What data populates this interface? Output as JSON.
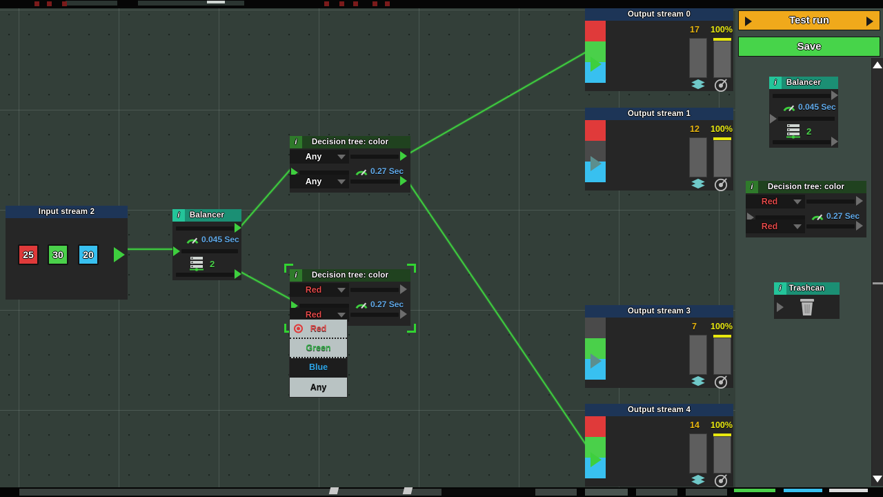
{
  "app": {
    "background_color": "#333f39",
    "wire_color": "#3ecf3e"
  },
  "sidebar": {
    "test_run_label": "Test run",
    "save_label": "Save",
    "test_run_color": "#f0a91b",
    "save_color": "#47d44a",
    "palette": [
      {
        "type": "balancer",
        "title": "Balancer",
        "badge": "i",
        "gauge_value": "0.045 Sec",
        "count_value": "2"
      },
      {
        "type": "decision-tree",
        "title": "Decision tree: color",
        "badge": "i",
        "slot_top": "Red",
        "slot_bottom": "Red",
        "gauge_value": "0.27 Sec"
      },
      {
        "type": "trashcan",
        "title": "Trashcan",
        "badge": "i"
      }
    ]
  },
  "canvas": {
    "input_streams": [
      {
        "title": "Input stream 2",
        "chips": [
          {
            "value": "25",
            "color": "#e03a3a"
          },
          {
            "value": "30",
            "color": "#4ad04a"
          },
          {
            "value": "20",
            "color": "#38c0f0"
          }
        ]
      }
    ],
    "output_streams": [
      {
        "title": "Output stream 0",
        "count": "17",
        "percent": "100%",
        "play_state": "active",
        "chips": [
          {
            "color": "#e03a3a"
          },
          {
            "color": "#4ad04a"
          },
          {
            "color": "#38c0f0"
          }
        ]
      },
      {
        "title": "Output stream 1",
        "count": "12",
        "percent": "100%",
        "play_state": "dim",
        "chips": [
          {
            "color": "#e03a3a"
          },
          {
            "color": "#4a4a4a"
          },
          {
            "color": "#38c0f0"
          }
        ]
      },
      {
        "title": "Output stream 3",
        "count": "7",
        "percent": "100%",
        "play_state": "dim",
        "chips": [
          {
            "color": "#4a4a4a"
          },
          {
            "color": "#4ad04a"
          },
          {
            "color": "#38c0f0"
          }
        ]
      },
      {
        "title": "Output stream 4",
        "count": "14",
        "percent": "100%",
        "play_state": "active",
        "chips": [
          {
            "color": "#e03a3a"
          },
          {
            "color": "#4ad04a"
          },
          {
            "color": "#38c0f0"
          }
        ]
      }
    ],
    "balancer": {
      "title": "Balancer",
      "badge": "i",
      "gauge_value": "0.045 Sec",
      "count_value": "2"
    },
    "decision_tree_top": {
      "title": "Decision tree: color",
      "badge": "i",
      "slot_top": "Any",
      "slot_bottom": "Any",
      "gauge_value": "0.27 Sec",
      "selected": false
    },
    "decision_tree_bottom": {
      "title": "Decision tree: color",
      "badge": "i",
      "slot_top": "Red",
      "slot_bottom": "Red",
      "gauge_value": "0.27 Sec",
      "selected": true
    },
    "dropdown": {
      "open": true,
      "selected": "Red",
      "hovered": "Blue",
      "options": [
        {
          "label": "Red",
          "color": "#e04a4a"
        },
        {
          "label": "Green",
          "color": "#35b24a"
        },
        {
          "label": "Blue",
          "color": "#2fa6e8"
        },
        {
          "label": "Any",
          "color": "#111111"
        }
      ]
    }
  },
  "colors": {
    "red": "#e03a3a",
    "green": "#4ad04a",
    "blue": "#38c0f0",
    "empty": "#4a4a4a",
    "gauge_text": "#5fa8e8",
    "count_text": "#4ad04a",
    "metric_num": "#e8b50f",
    "metric_pct": "#e8e80f"
  }
}
